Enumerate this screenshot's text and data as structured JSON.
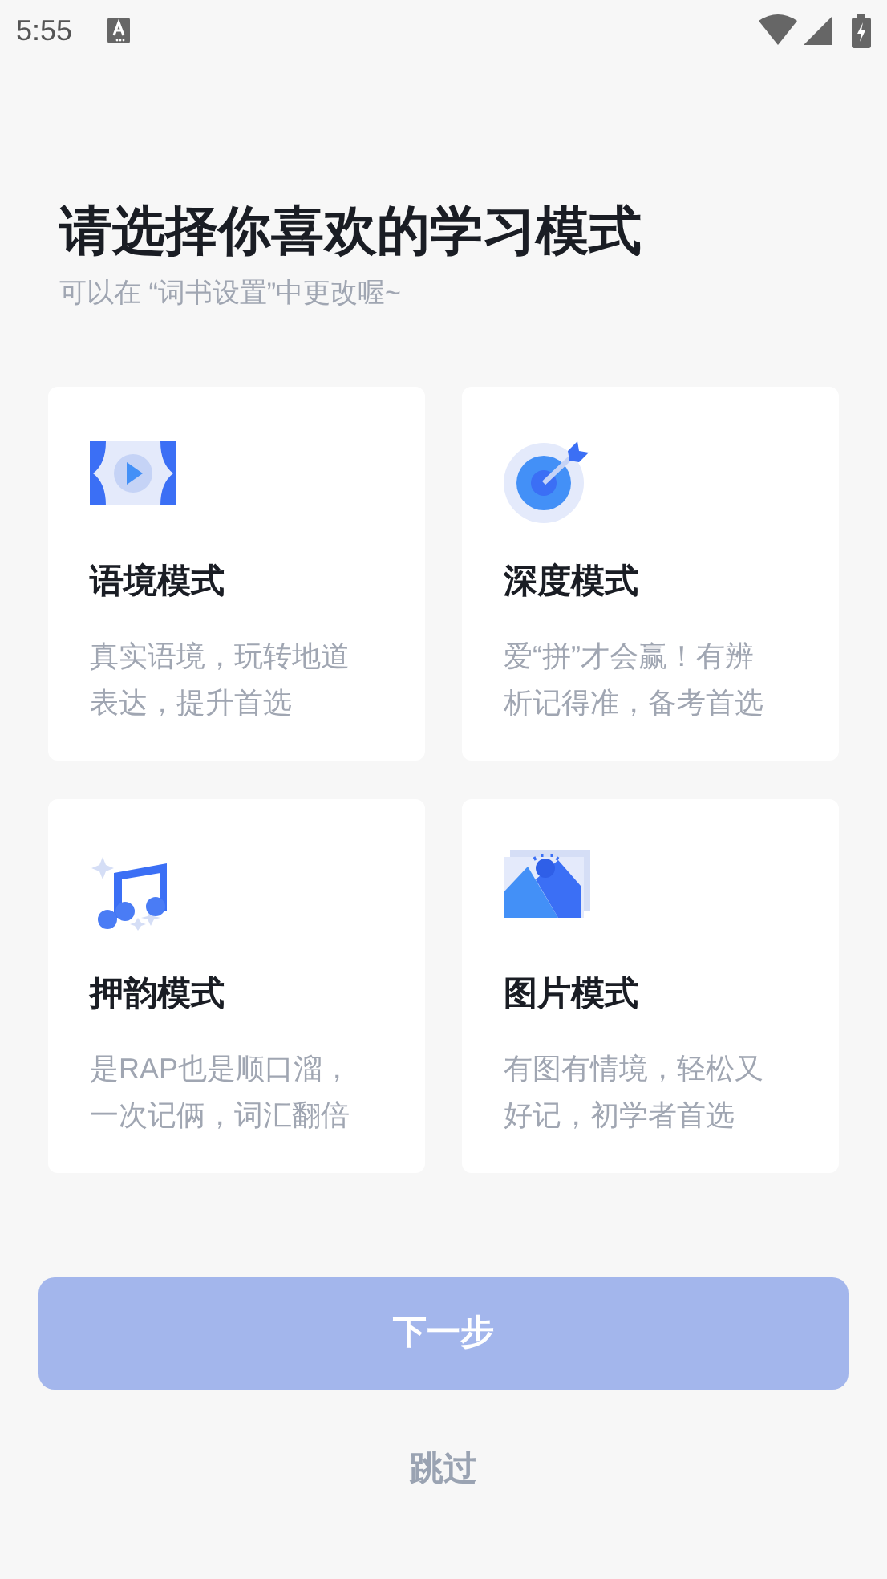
{
  "status_bar": {
    "time": "5:55"
  },
  "title": "请选择你喜欢的学习模式",
  "subtitle": "可以在 “词书设置”中更改喔~",
  "modes": [
    {
      "kind": "video",
      "name": "语境模式",
      "description": "真实语境，玩转地道表达，提升首选",
      "selected": false
    },
    {
      "kind": "target",
      "name": "深度模式",
      "description": "爱“拼”才会赢！有辨析记得准，备考首选",
      "selected": false
    },
    {
      "kind": "music",
      "name": "押韵模式",
      "description": "是RAP也是顺口溜，一次记俩，词汇翻倍",
      "selected": false
    },
    {
      "kind": "image",
      "name": "图片模式",
      "description": "有图有情境，轻松又好记，初学者首选",
      "selected": false
    }
  ],
  "next_button": {
    "label": "下一步",
    "disabled": true
  },
  "skip_link": "跳过"
}
